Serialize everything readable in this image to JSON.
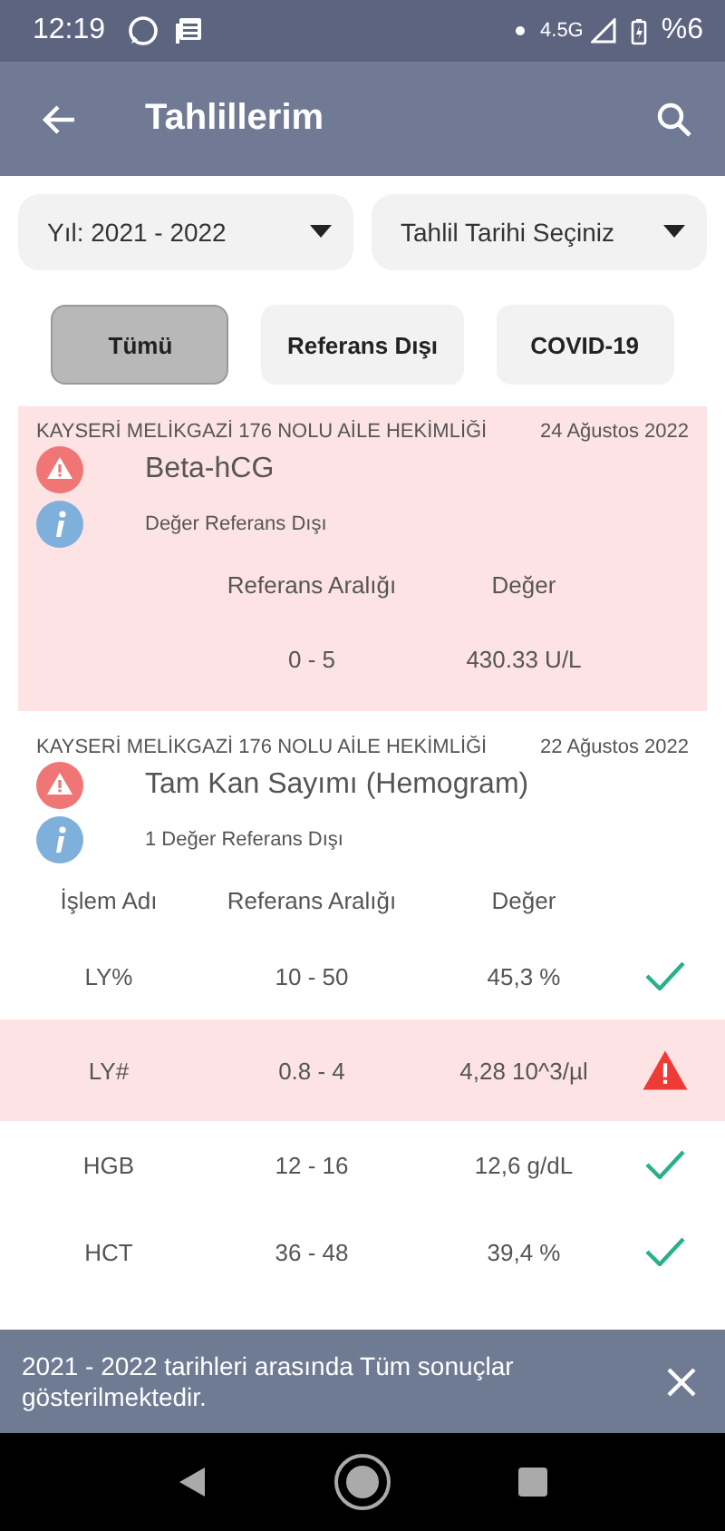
{
  "status_bar": {
    "time": "12:19",
    "network": "4.5G",
    "battery": "%6"
  },
  "app_bar": {
    "title": "Tahlillerim"
  },
  "filters": [
    {
      "label": "Yıl: 2021 - 2022"
    },
    {
      "label": "Tahlil Tarihi Seçiniz"
    }
  ],
  "tabs": [
    {
      "label": "Tümü",
      "selected": true
    },
    {
      "label": "Referans Dışı",
      "selected": false
    },
    {
      "label": "COVID-19",
      "selected": false
    }
  ],
  "results": [
    {
      "facility": "KAYSERİ MELİKGAZİ 176 NOLU AİLE HEKİMLİĞİ",
      "date": "24 Ağustos 2022",
      "test": "Beta-hCG",
      "note": "Değer Referans Dışı",
      "out_of_range": true,
      "columns": [
        "Referans Aralığı",
        "Değer"
      ],
      "rows": [
        {
          "range": "0 - 5",
          "value": "430.33 U/L"
        }
      ]
    },
    {
      "facility": "KAYSERİ MELİKGAZİ 176 NOLU AİLE HEKİMLİĞİ",
      "date": "22 Ağustos 2022",
      "test": "Tam Kan Sayımı (Hemogram)",
      "note": "1 Değer Referans Dışı",
      "out_of_range": false,
      "columns": [
        "İşlem Adı",
        "Referans Aralığı",
        "Değer"
      ],
      "rows": [
        {
          "name": "LY%",
          "range": "10 - 50",
          "value": "45,3 %",
          "out_of_range": false
        },
        {
          "name": "LY#",
          "range": "0.8 - 4",
          "value": "4,28 10^3/µl",
          "out_of_range": true
        },
        {
          "name": "HGB",
          "range": "12 - 16",
          "value": "12,6 g/dL",
          "out_of_range": false
        },
        {
          "name": "HCT",
          "range": "36 - 48",
          "value": "39,4 %",
          "out_of_range": false
        }
      ]
    }
  ],
  "snackbar": {
    "message": "2021 - 2022 tarihleri arasında Tüm sonuçlar gösterilmektedir."
  }
}
